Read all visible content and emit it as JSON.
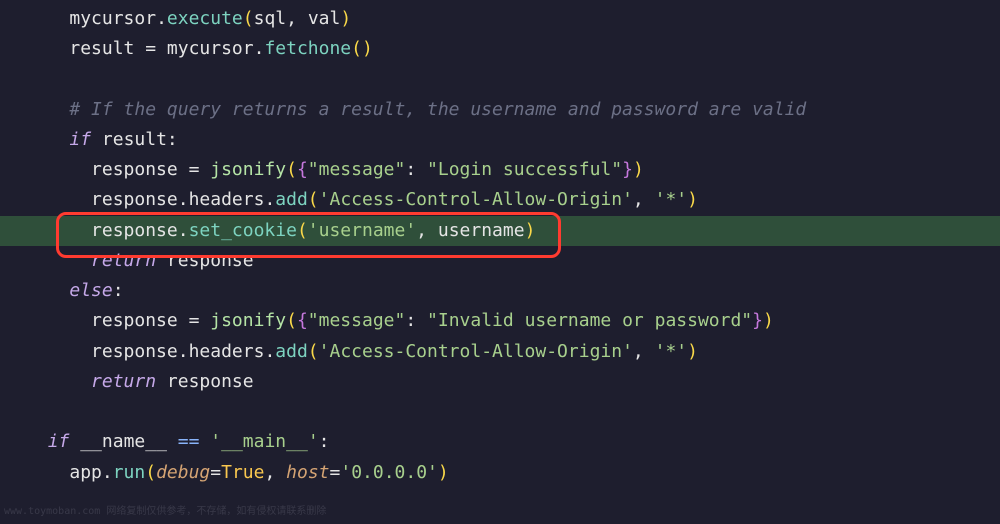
{
  "code": {
    "line1": {
      "indent": "    ",
      "var1": "mycursor",
      "dot1": ".",
      "method1": "execute",
      "paren_open": "(",
      "arg1": "sql",
      "comma": ", ",
      "arg2": "val",
      "paren_close": ")"
    },
    "line2": {
      "indent": "    ",
      "var1": "result",
      "eq": " = ",
      "var2": "mycursor",
      "dot": ".",
      "method": "fetchone",
      "parens": "()"
    },
    "line3": "",
    "line4": {
      "indent": "    ",
      "comment": "# If the query returns a result, the username and password are valid"
    },
    "line5": {
      "indent": "    ",
      "keyword": "if",
      "space": " ",
      "var": "result",
      "colon": ":"
    },
    "line6": {
      "indent": "      ",
      "var": "response",
      "eq": " = ",
      "func": "jsonify",
      "paren_open": "(",
      "brace_open": "{",
      "key": "\"message\"",
      "colon": ": ",
      "val": "\"Login successful\"",
      "brace_close": "}",
      "paren_close": ")"
    },
    "line7": {
      "indent": "      ",
      "var": "response",
      "dot1": ".",
      "attr": "headers",
      "dot2": ".",
      "method": "add",
      "paren_open": "(",
      "arg1": "'Access-Control-Allow-Origin'",
      "comma": ", ",
      "arg2": "'*'",
      "paren_close": ")"
    },
    "line8": {
      "indent": "      ",
      "var": "response",
      "dot": ".",
      "method": "set_cookie",
      "paren_open": "(",
      "arg1": "'username'",
      "comma": ", ",
      "arg2": "username",
      "paren_close": ")"
    },
    "line9": {
      "indent": "      ",
      "keyword": "return",
      "space": " ",
      "var": "response"
    },
    "line10": {
      "indent": "    ",
      "keyword": "else",
      "colon": ":"
    },
    "line11": {
      "indent": "      ",
      "var": "response",
      "eq": " = ",
      "func": "jsonify",
      "paren_open": "(",
      "brace_open": "{",
      "key": "\"message\"",
      "colon": ": ",
      "val": "\"Invalid username or password\"",
      "brace_close": "}",
      "paren_close": ")"
    },
    "line12": {
      "indent": "      ",
      "var": "response",
      "dot1": ".",
      "attr": "headers",
      "dot2": ".",
      "method": "add",
      "paren_open": "(",
      "arg1": "'Access-Control-Allow-Origin'",
      "comma": ", ",
      "arg2": "'*'",
      "paren_close": ")"
    },
    "line13": {
      "indent": "      ",
      "keyword": "return",
      "space": " ",
      "var": "response"
    },
    "line14": "",
    "line15": {
      "indent": "  ",
      "keyword": "if",
      "space": " ",
      "var": "__name__",
      "eq": " == ",
      "str": "'__main__'",
      "colon": ":"
    },
    "line16": {
      "indent": "    ",
      "var": "app",
      "dot": ".",
      "method": "run",
      "paren_open": "(",
      "param1": "debug",
      "eq1": "=",
      "val1": "True",
      "comma": ", ",
      "param2": "host",
      "eq2": "=",
      "val2": "'0.0.0.0'",
      "paren_close": ")"
    }
  },
  "watermark": "www.toymoban.com 网络复制仅供参考，不存储，如有侵权请联系删除"
}
